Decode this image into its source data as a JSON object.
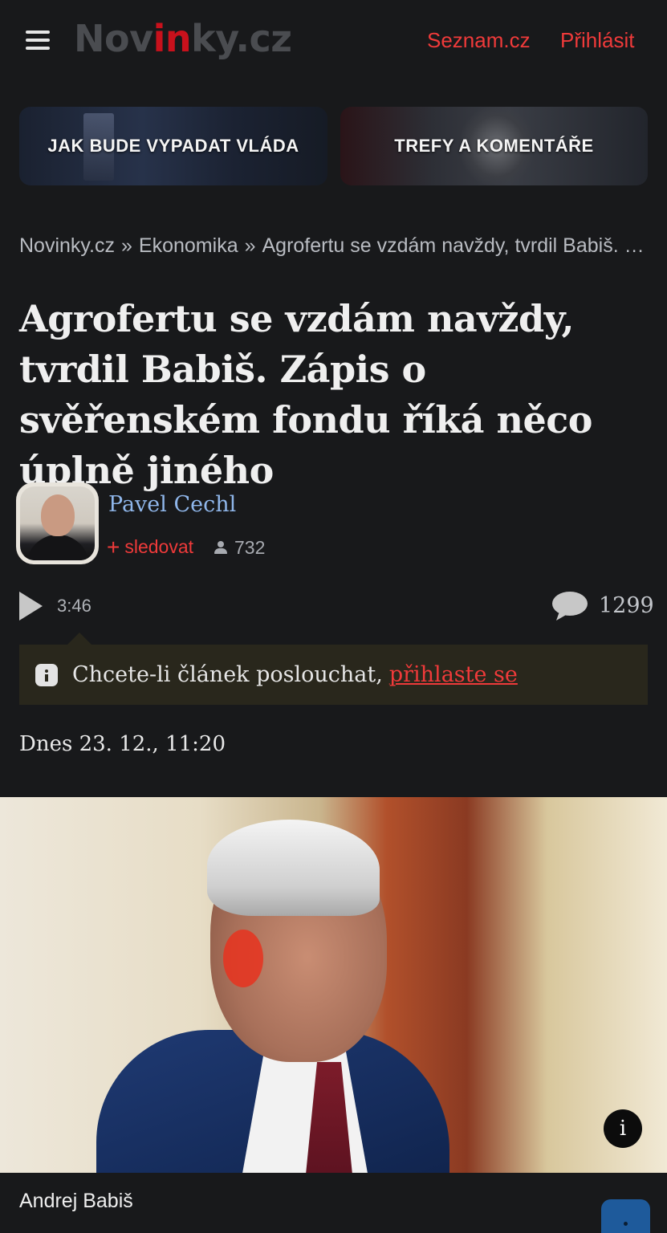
{
  "header": {
    "logo_prefix": "Nov",
    "logo_accent": "in",
    "logo_suffix": "ky.cz",
    "seznam_link": "Seznam.cz",
    "login_link": "Přihlásit"
  },
  "promo_tiles": [
    {
      "label": "JAK BUDE VYPADAT VLÁDA"
    },
    {
      "label": "TREFY A KOMENTÁŘE"
    }
  ],
  "breadcrumb": {
    "items": [
      "Novinky.cz",
      "Ekonomika",
      "Agrofertu se vzdám navždy, tvrdil Babiš. Zápis o svěřenském fondu říká něco úplně jiného"
    ],
    "separator": "»"
  },
  "article": {
    "title": "Agrofertu se vzdám navždy, tvrdil Babiš. Zápis o svěřenském fondu říká něco úplně jiného",
    "author": "Pavel Cechl",
    "follow_label": "sledovat",
    "follow_plus": "+",
    "followers_count": "732",
    "audio_duration": "3:46",
    "comments_count": "1299",
    "notice_text": "Chcete-li článek poslouchat,",
    "notice_link": "přihlaste se",
    "date": "Dnes 23. 12., 11:20",
    "photo_caption": "Andrej Babiš",
    "info_button": "i"
  },
  "colors": {
    "background": "#18191b",
    "accent_red": "#ef3a3a",
    "author_blue": "#8fb6ea",
    "notice_bg": "#29271c"
  }
}
